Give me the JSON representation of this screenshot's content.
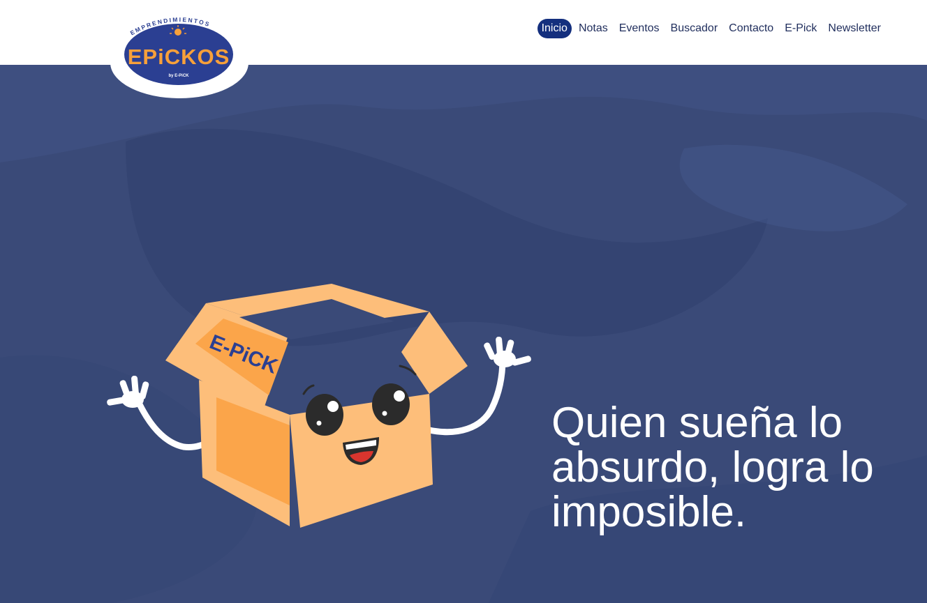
{
  "brand": {
    "logo_arc_text": "EMPRENDIMIENTOS",
    "logo_main_text": "EPiCKOS",
    "logo_sub_text": "by E-PiCK",
    "colors": {
      "navy": "#2b3f92",
      "orange": "#f7a03a",
      "white": "#ffffff"
    }
  },
  "nav": {
    "items": [
      {
        "label": "Inicio",
        "active": true
      },
      {
        "label": "Notas"
      },
      {
        "label": "Eventos"
      },
      {
        "label": "Buscador"
      },
      {
        "label": "Contacto"
      },
      {
        "label": "E-Pick"
      },
      {
        "label": "Newsletter"
      }
    ],
    "active_color": "#142f7e"
  },
  "hero": {
    "background_color": "#3a4a78",
    "quote": "Quien sueña lo absurdo, logra lo imposible.",
    "mascot": {
      "box_label": "E-PiCK",
      "icon": "smiling-box-mascot"
    }
  }
}
